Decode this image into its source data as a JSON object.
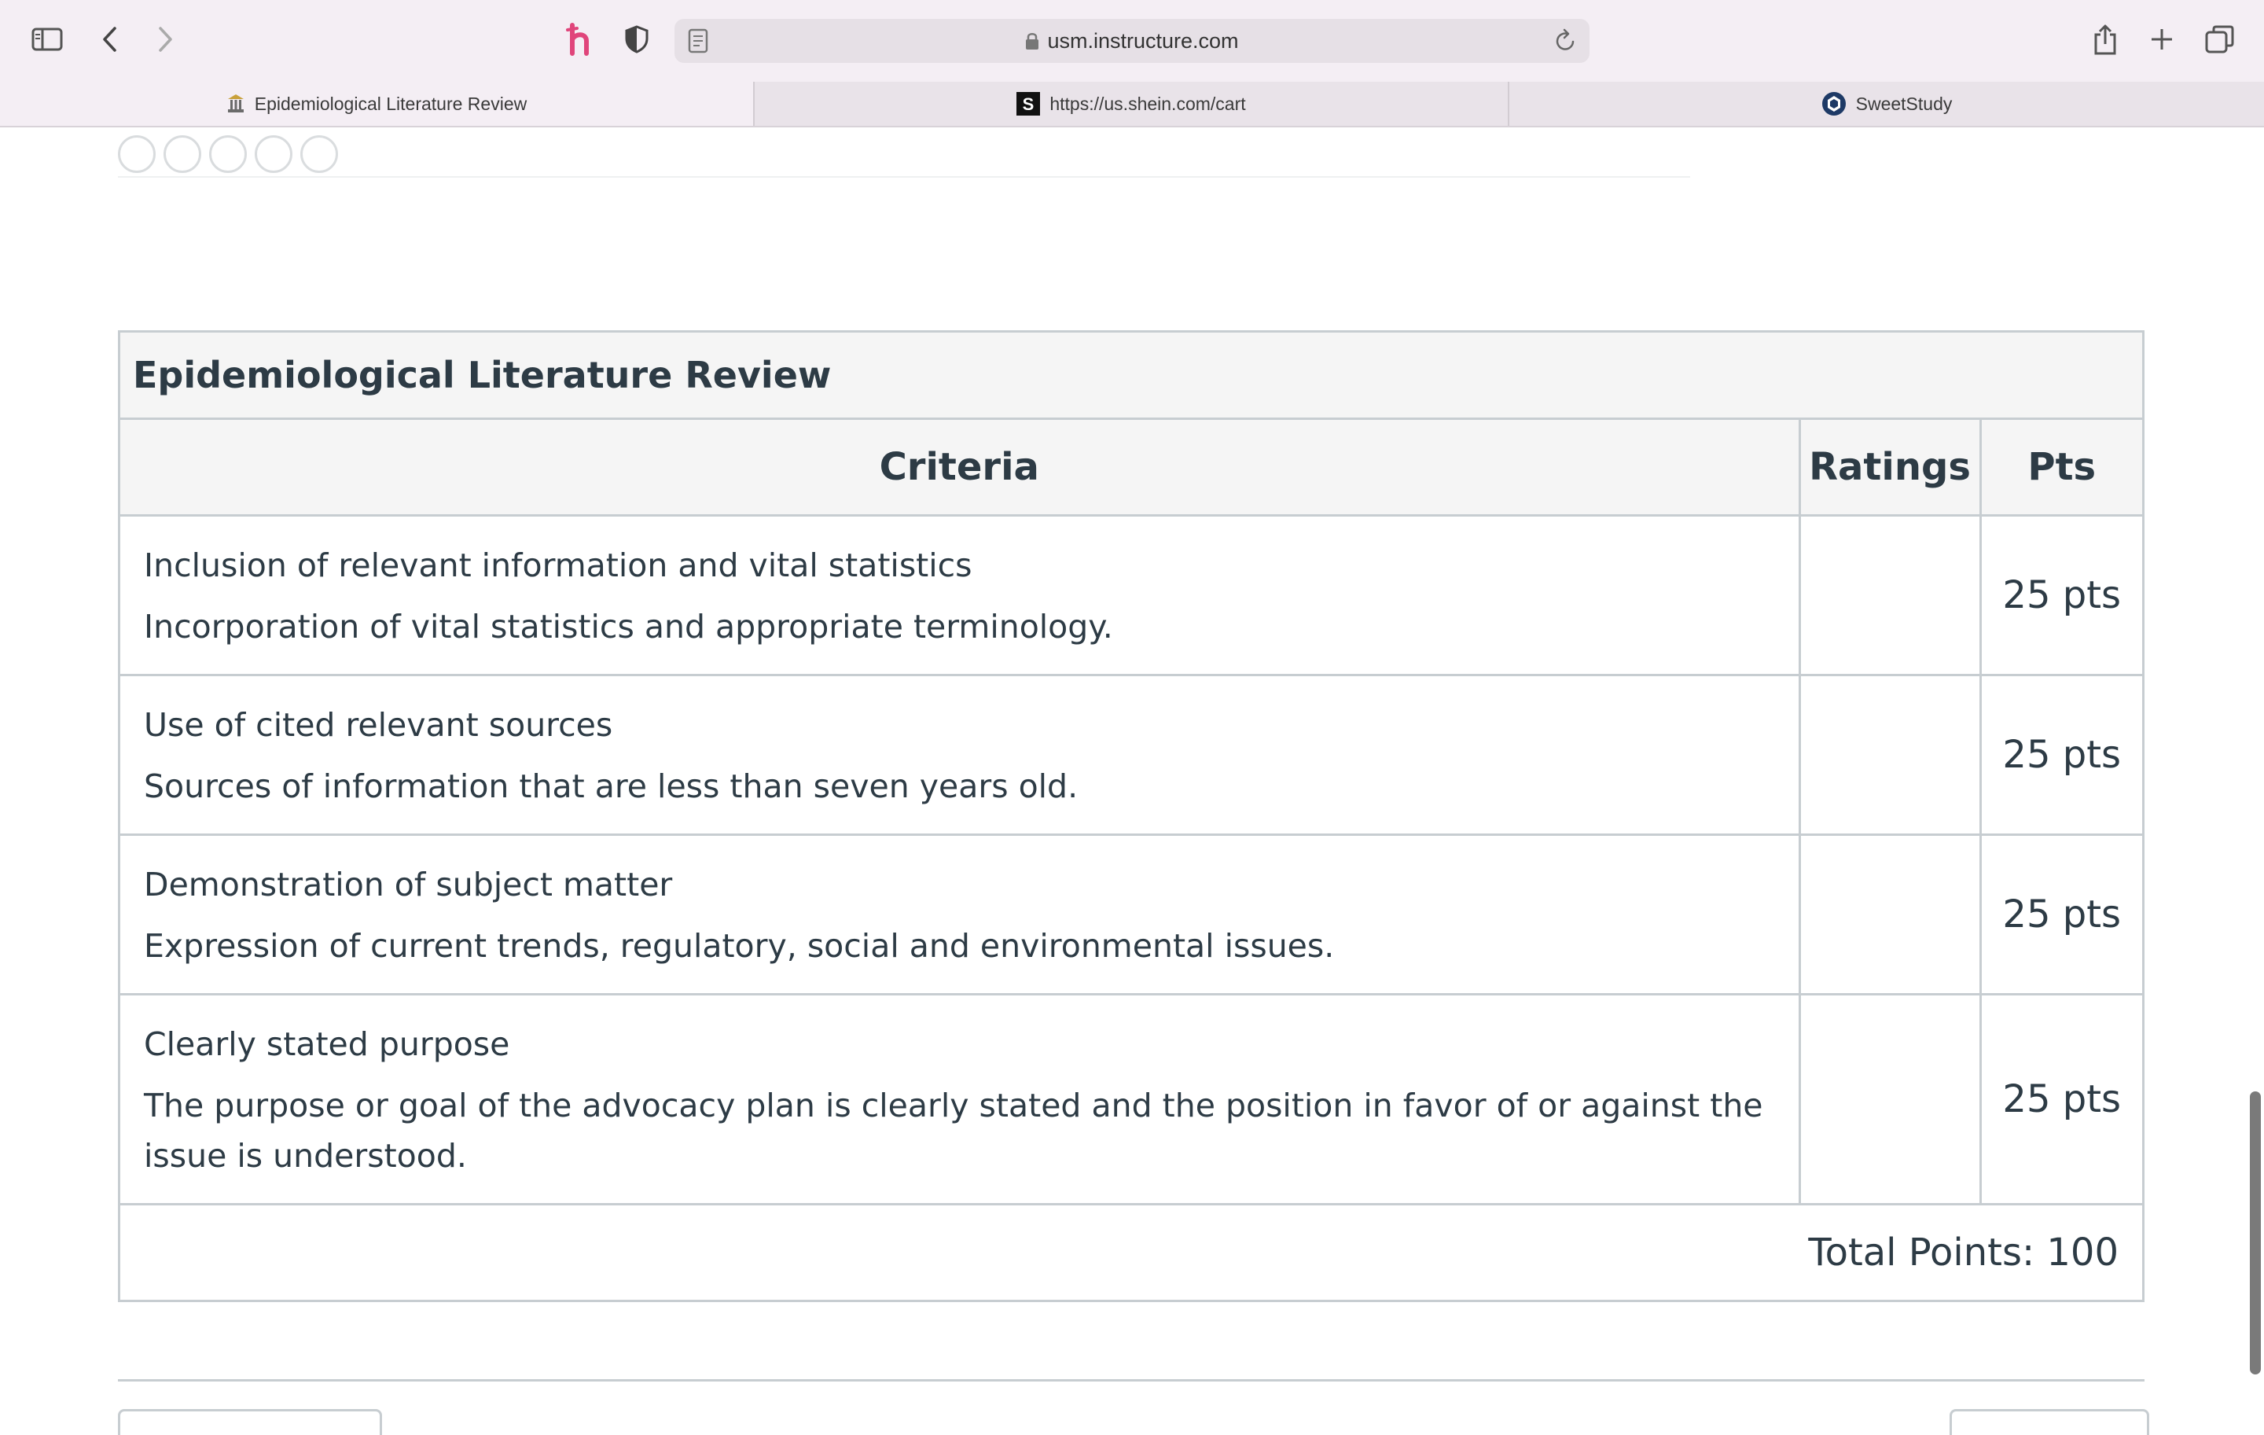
{
  "browser": {
    "url": "usm.instructure.com",
    "tabs": [
      {
        "title": "Epidemiological Literature Review",
        "icon": "canvas-favicon-icon",
        "active": true
      },
      {
        "title": "https://us.shein.com/cart",
        "icon": "shein-favicon-icon",
        "active": false
      },
      {
        "title": "SweetStudy",
        "icon": "sweetstudy-favicon-icon",
        "active": false
      }
    ],
    "accent_color": "#e0457b"
  },
  "rubric": {
    "title": "Epidemiological Literature Review",
    "headers": {
      "criteria": "Criteria",
      "ratings": "Ratings",
      "pts": "Pts"
    },
    "rows": [
      {
        "title": "Inclusion of relevant information and vital statistics",
        "description": "Incorporation of vital statistics and appropriate terminology.",
        "pts": "25 pts"
      },
      {
        "title": "Use of cited relevant sources",
        "description": "Sources of information that are less than seven years old.",
        "pts": "25 pts"
      },
      {
        "title": "Demonstration of subject matter",
        "description": "Expression of current trends, regulatory, social and environmental issues.",
        "pts": "25 pts"
      },
      {
        "title": "Clearly stated purpose",
        "description": "The purpose or goal of the advocacy plan is clearly stated and the position in favor of or against the issue is understood.",
        "pts": "25 pts"
      }
    ],
    "total": "Total Points: 100"
  }
}
